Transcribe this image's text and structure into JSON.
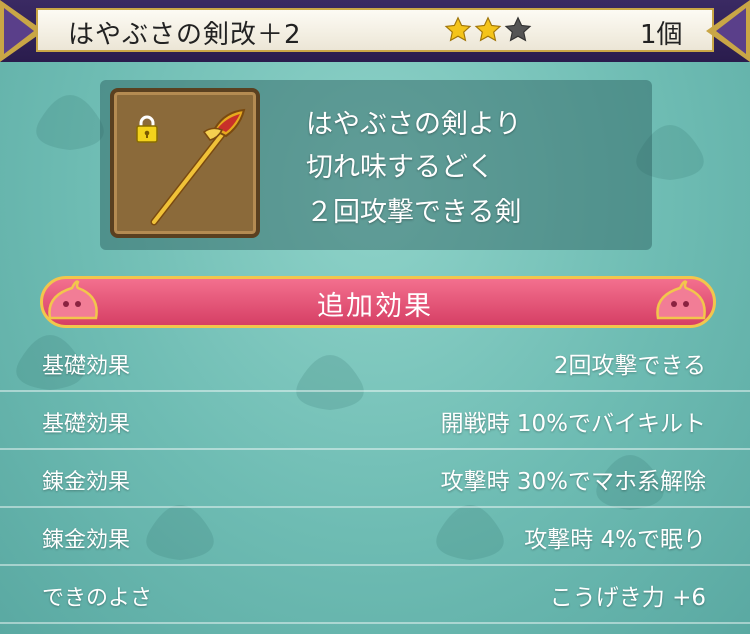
{
  "header": {
    "item_name": "はやぶさの剣改＋2",
    "rarity": {
      "filled": 2,
      "total": 3
    },
    "count": "1個"
  },
  "colors": {
    "star_gold": "#f4c41a",
    "star_empty": "#555555",
    "banner_pink": "#e2506f",
    "banner_border": "#f2c64c",
    "background": "#78c4bb"
  },
  "item": {
    "icon": "sword-icon",
    "locked": true,
    "description": [
      "はやぶさの剣より",
      "切れ味するどく",
      "２回攻撃できる剣"
    ]
  },
  "effects": {
    "title": "追加効果",
    "rows": [
      {
        "label": "基礎効果",
        "value": "2回攻撃できる"
      },
      {
        "label": "基礎効果",
        "value": "開戦時  10%でバイキルト"
      },
      {
        "label": "錬金効果",
        "value": "攻撃時  30%でマホ系解除"
      },
      {
        "label": "錬金効果",
        "value": "攻撃時  4%で眠り"
      },
      {
        "label": "できのよさ",
        "value": "こうげき力 +6"
      }
    ]
  }
}
